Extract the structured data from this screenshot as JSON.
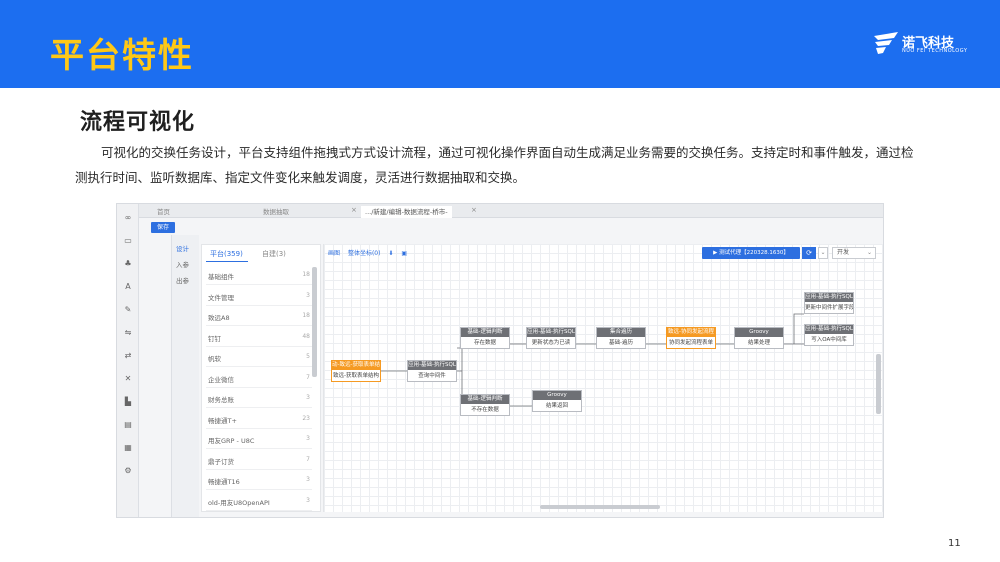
{
  "slide": {
    "title": "平台特性",
    "section": "流程可视化",
    "description": "可视化的交换任务设计，平台支持组件拖拽式方式设计流程，通过可视化操作界面自动生成满足业务需要的交换任务。支持定时和事件触发，通过检测执行时间、监听数据库、指定文件变化来触发调度，灵活进行数据抽取和交换。",
    "page_number": "11",
    "colors": {
      "banner": "#1c6ef0",
      "title": "#ffc816",
      "accent": "#2d6fe0",
      "node_head": "#6e7075",
      "node_selected": "#f59a23"
    }
  },
  "logo": {
    "name": "诺飞科技",
    "subtitle": "NUO FEI TECHNOLOGY",
    "icon": "nuofei-logo-icon"
  },
  "screenshot": {
    "tabs": [
      {
        "label": "首页"
      },
      {
        "label": "数据抽取"
      },
      {
        "label": ".../新建/编辑-数据流程-桥市-"
      }
    ],
    "save_label": "保存",
    "sidebar_icons": [
      "link-icon",
      "monitor-icon",
      "users-icon",
      "font-icon",
      "pen-icon",
      "shuffle-icon",
      "swap-icon",
      "random-icon",
      "grid-icon",
      "file-icon",
      "table-icon",
      "gear-icon"
    ],
    "design_menu": [
      {
        "label": "设计",
        "active": true
      },
      {
        "label": "入参"
      },
      {
        "label": "出参"
      }
    ],
    "panel_tabs": [
      {
        "label": "平台(359)",
        "active": true
      },
      {
        "label": "自建(3)"
      }
    ],
    "components": [
      {
        "name": "基础组件",
        "count": "18"
      },
      {
        "name": "文件管理",
        "count": "3"
      },
      {
        "name": "致远A8",
        "count": "18"
      },
      {
        "name": "钉钉",
        "count": "48"
      },
      {
        "name": "帆软",
        "count": "5"
      },
      {
        "name": "企业微信",
        "count": "7"
      },
      {
        "name": "财务总账",
        "count": "3"
      },
      {
        "name": "畅捷通T+",
        "count": "23"
      },
      {
        "name": "用友GRP - U8C",
        "count": "3"
      },
      {
        "name": "鼎子订货",
        "count": "7"
      },
      {
        "name": "畅捷通T16",
        "count": "3"
      },
      {
        "name": "old-用友U8OpenAPI",
        "count": "3"
      }
    ],
    "toolbar": {
      "links": [
        "画图",
        "整体坐标(0)"
      ],
      "run_label": "▶ 测试代理【220328.1630】",
      "refresh_icon": "⟳",
      "env_label": "开发"
    },
    "nodes": [
      {
        "head": "动-致远-获取表单结构",
        "body": "致远-获取表单结构",
        "orange": true
      },
      {
        "head": "应用-基础-执行SQL",
        "body": "查询中间件"
      },
      {
        "head": "基础-逻辑判断",
        "body": "存在数据"
      },
      {
        "head": "应用-基础-执行SQL",
        "body": "更新状态为已读"
      },
      {
        "head": "集合遍历",
        "body": "基础-遍历"
      },
      {
        "head": "致远-协同发起流程",
        "body": "协同发起流程表单",
        "orange": true
      },
      {
        "head": "Groovy",
        "body": "结果处理"
      },
      {
        "head": "应用-基础-执行SQL",
        "body": "更新中间件扩展字段值"
      },
      {
        "head": "应用-基础-执行SQL",
        "body": "写入OA中间库"
      },
      {
        "head": "基础-逻辑判断",
        "body": "不存在数据"
      },
      {
        "head": "Groovy",
        "body": "结果返回"
      }
    ]
  }
}
